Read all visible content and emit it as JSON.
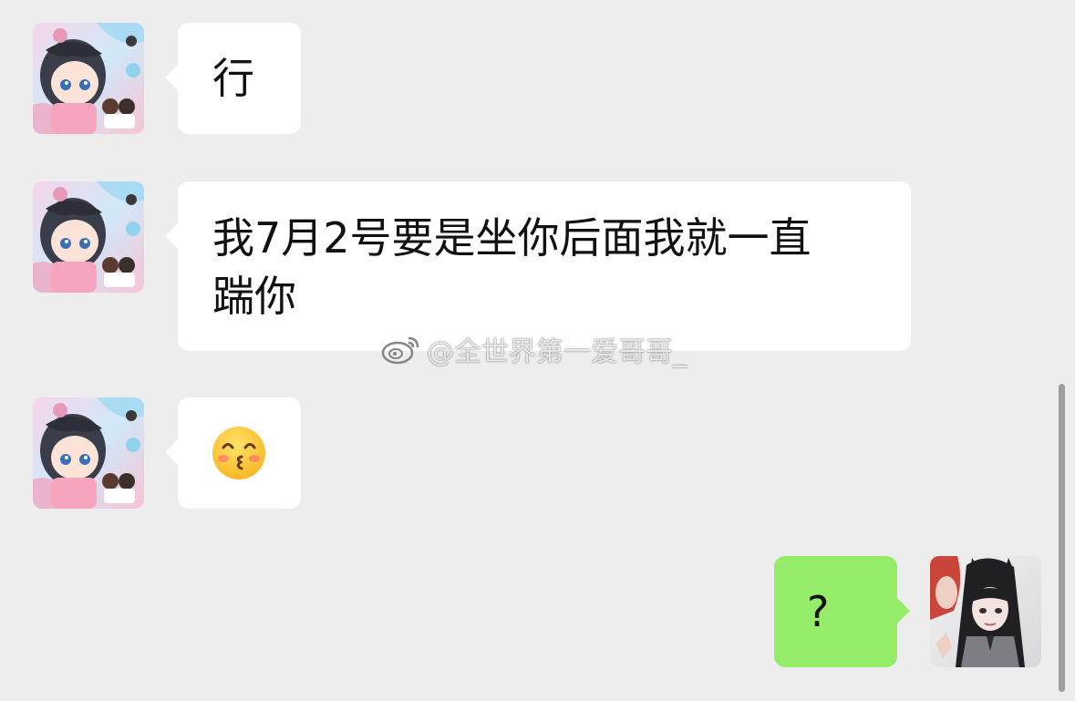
{
  "messages": [
    {
      "sender": "contact",
      "text": "行"
    },
    {
      "sender": "contact",
      "text": "我7月2号要是坐你后面我就一直",
      "text_line2": "踹你"
    },
    {
      "sender": "contact",
      "emoji": "kissing-face-with-smiling-eyes"
    },
    {
      "sender": "self",
      "text": "?"
    }
  ],
  "watermark": {
    "text": "@全世界第一爱哥哥_",
    "icon": "weibo-icon"
  },
  "colors": {
    "background": "#ededed",
    "incoming_bubble": "#ffffff",
    "outgoing_bubble": "#95ec69"
  }
}
